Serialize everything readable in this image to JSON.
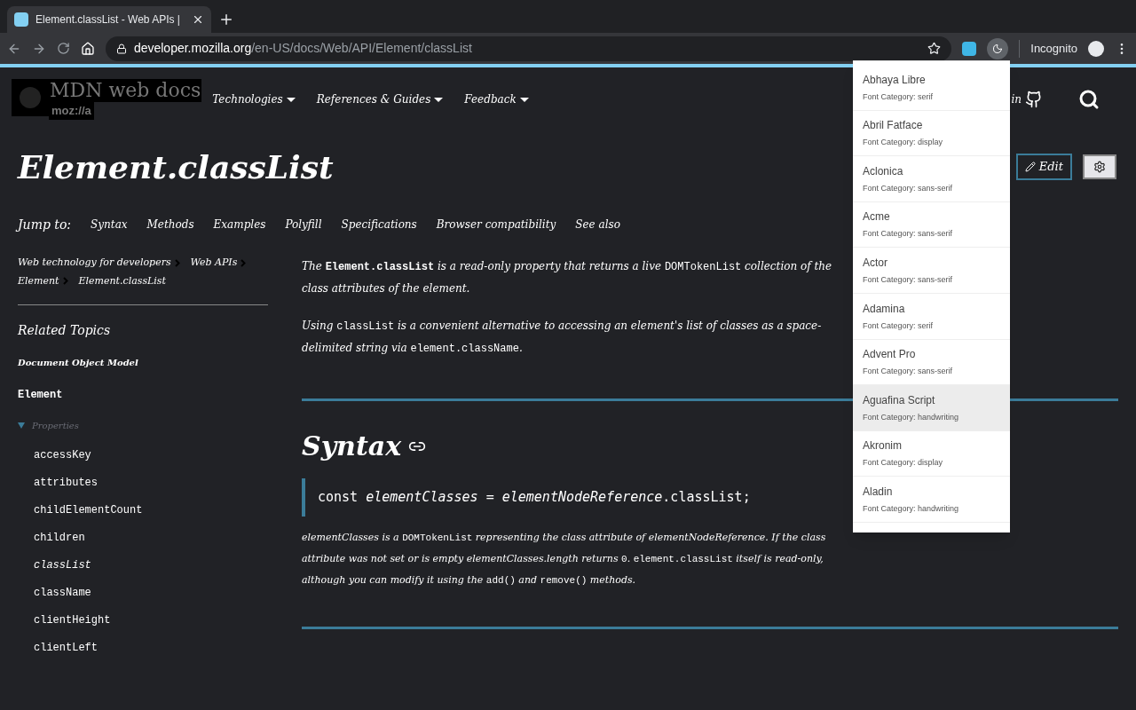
{
  "browser": {
    "tab_title": "Element.classList - Web APIs |",
    "url_host": "developer.mozilla.org",
    "url_path": "/en-US/docs/Web/API/Element/classList",
    "profile": "Incognito"
  },
  "header": {
    "logo_title": "MDN web docs",
    "logo_sub": "moz://a",
    "nav": [
      "Technologies",
      "References & Guides",
      "Feedback"
    ],
    "signin": "in"
  },
  "page": {
    "title": "Element.classList",
    "edit": "Edit",
    "jump_label": "Jump to:",
    "jump_links": [
      "Syntax",
      "Methods",
      "Examples",
      "Polyfill",
      "Specifications",
      "Browser compatibility",
      "See also"
    ]
  },
  "breadcrumbs": [
    "Web technology for developers",
    "Web APIs",
    "Element",
    "Element.classList"
  ],
  "sidebar": {
    "heading": "Related Topics",
    "group": "Document Object Model",
    "interface": "Element",
    "section": {
      "label": "Properties",
      "expanded": true,
      "children": [
        {
          "label": "accessKey",
          "selected": false
        },
        {
          "label": "attributes",
          "selected": false
        },
        {
          "label": "childElementCount",
          "selected": false
        },
        {
          "label": "children",
          "selected": false
        },
        {
          "label": "classList",
          "selected": true
        },
        {
          "label": "className",
          "selected": false
        },
        {
          "label": "clientHeight",
          "selected": false
        },
        {
          "label": "clientLeft",
          "selected": false
        }
      ]
    }
  },
  "content": {
    "intro": [
      [
        {
          "kind": "text",
          "text": "The "
        },
        {
          "kind": "strongcode",
          "text": "Element.classList"
        },
        {
          "kind": "text",
          "text": " is a read-only property that returns a live "
        },
        {
          "kind": "code",
          "text": "DOMTokenList"
        },
        {
          "kind": "text",
          "text": " collection of the class attributes of the element."
        }
      ],
      [
        {
          "kind": "text",
          "text": "Using "
        },
        {
          "kind": "code",
          "text": "classList"
        },
        {
          "kind": "text",
          "text": " is a convenient alternative to accessing an element's list of classes as a space-delimited string via "
        },
        {
          "kind": "code",
          "text": "element.className"
        },
        {
          "kind": "text",
          "text": "."
        }
      ]
    ],
    "syntax_heading": "Syntax",
    "code": [
      {
        "kind": "plain",
        "text": "const "
      },
      {
        "kind": "var",
        "text": "elementClasses"
      },
      {
        "kind": "plain",
        "text": " = "
      },
      {
        "kind": "var",
        "text": "elementNodeReference"
      },
      {
        "kind": "plain",
        "text": ".classList;"
      }
    ],
    "syntax_text": [
      {
        "kind": "text",
        "text": "elementClasses is a "
      },
      {
        "kind": "code",
        "text": "DOMTokenList"
      },
      {
        "kind": "text",
        "text": " representing the class attribute of elementNodeReference. If the class attribute was not set or is empty elementClasses.length returns "
      },
      {
        "kind": "code",
        "text": "0"
      },
      {
        "kind": "text",
        "text": ". "
      },
      {
        "kind": "code",
        "text": "element.classList"
      },
      {
        "kind": "text",
        "text": " itself is read-only, although you can modify it using the "
      },
      {
        "kind": "code",
        "text": "add()"
      },
      {
        "kind": "text",
        "text": " and "
      },
      {
        "kind": "code",
        "text": "remove()"
      },
      {
        "kind": "text",
        "text": " methods."
      }
    ]
  },
  "font_menu": [
    {
      "name": "Abhaya Libre",
      "category": "Font Category: serif",
      "selected": false
    },
    {
      "name": "Abril Fatface",
      "category": "Font Category: display",
      "selected": false
    },
    {
      "name": "Aclonica",
      "category": "Font Category: sans-serif",
      "selected": false
    },
    {
      "name": "Acme",
      "category": "Font Category: sans-serif",
      "selected": false
    },
    {
      "name": "Actor",
      "category": "Font Category: sans-serif",
      "selected": false
    },
    {
      "name": "Adamina",
      "category": "Font Category: serif",
      "selected": false
    },
    {
      "name": "Advent Pro",
      "category": "Font Category: sans-serif",
      "selected": false
    },
    {
      "name": "Aguafina Script",
      "category": "Font Category: handwriting",
      "selected": true
    },
    {
      "name": "Akronim",
      "category": "Font Category: display",
      "selected": false
    },
    {
      "name": "Aladin",
      "category": "Font Category: handwriting",
      "selected": false
    }
  ]
}
